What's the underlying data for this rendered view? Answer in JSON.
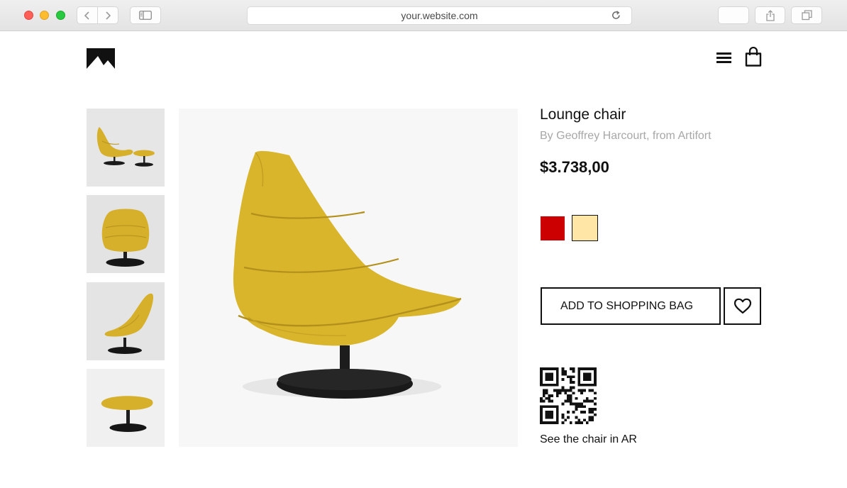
{
  "browser": {
    "url": "your.website.com"
  },
  "product": {
    "title": "Lounge chair",
    "byline": "By Geoffrey Harcourt, from Artifort",
    "price": "$3.738,00",
    "colors": [
      "#cc0000",
      "#ffe6a6"
    ],
    "selected_color_index": 1,
    "add_to_bag_label": "ADD TO SHOPPING BAG",
    "ar_label": "See the chair in AR"
  },
  "icons": {
    "logo": "mountain-logo-icon",
    "menu": "hamburger-menu-icon",
    "bag": "shopping-bag-icon",
    "wishlist": "heart-icon",
    "qr": "qr-code-icon"
  },
  "colors": {
    "chair": "#d9b52c",
    "accent_text": "#111111",
    "muted_text": "#a7a7a7"
  }
}
